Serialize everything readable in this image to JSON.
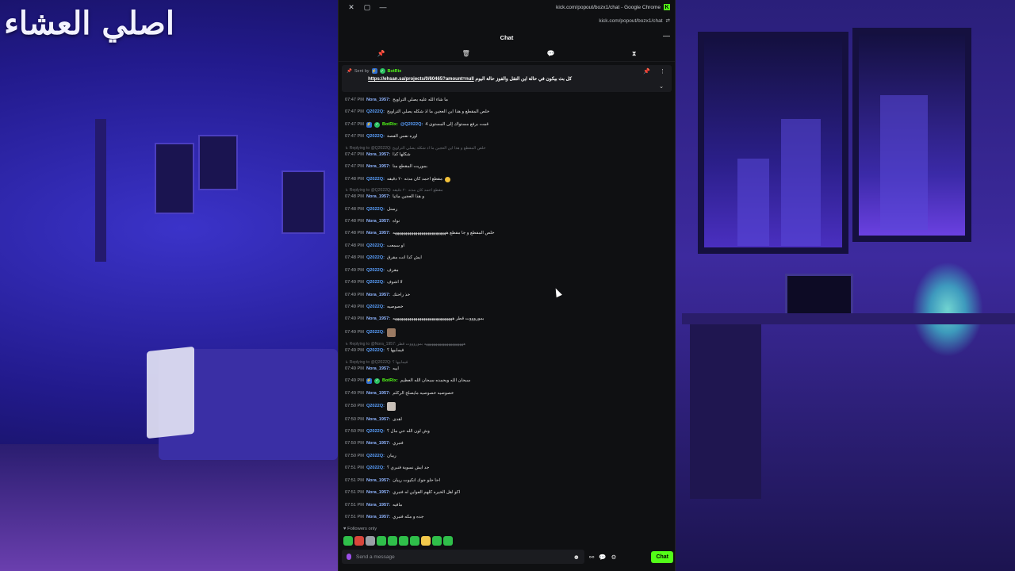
{
  "overlay_text": "اصلي العشاء",
  "window": {
    "title": "kick.com/popout/bozx1/chat - Google Chrome",
    "url": "kick.com/popout/bozx1/chat"
  },
  "chat": {
    "header": "Chat",
    "pinned": {
      "sent_by_label": "Sent by",
      "sender": "BotRix",
      "text": "كل بث بيكون في حالة اين التقل والفوز حالة اليوم",
      "link": "https://ehsan.sa/projects/0/60465?amount=null"
    },
    "messages": [
      {
        "time": "07:47 PM",
        "user": "Nora_1957",
        "ucls": "u-nora",
        "text": "ما شاء الله عليه يصلي التراويح"
      },
      {
        "time": "07:47 PM",
        "user": "Q2022Q",
        "ucls": "u-q",
        "text": "خلص المقطع و هذا اين العجين ما اذ شكله يصلي التراويح"
      },
      {
        "time": "07:47 PM",
        "user": "@Q2022Q",
        "ucls": "u-q",
        "bot_prefix": "BotRix",
        "text": "قمت برفع مستواك إلى المستوى 4"
      },
      {
        "time": "07:47 PM",
        "user": "Q2022Q",
        "ucls": "u-q",
        "text": "اوره نفس الفصة"
      },
      {
        "reply": "Replying to @Q2022Q: خلص المقطع و هذا اين العجين ما اذ شكله يصلي التراويح",
        "time": "07:47 PM",
        "user": "Nora_1957",
        "ucls": "u-nora",
        "text": "شكلها كذا"
      },
      {
        "time": "07:47 PM",
        "user": "Nora_1957",
        "ucls": "u-nora",
        "text": "بموريت المقطع منا"
      },
      {
        "time": "07:48 PM",
        "user": "Q2022Q",
        "ucls": "u-q",
        "text": "مقطع احمد كان مدته ٢٠ دقيقه",
        "emoji": true
      },
      {
        "reply": "Replying to @Q2022Q: مقطع احمد كان مدته ٢٠ دقيقه",
        "time": "07:48 PM",
        "user": "Nora_1957",
        "ucls": "u-nora",
        "text": "و هذا العجين ماتيا"
      },
      {
        "time": "07:48 PM",
        "user": "Q2022Q",
        "ucls": "u-q",
        "text": "رسنل"
      },
      {
        "time": "07:48 PM",
        "user": "Nora_1957",
        "ucls": "u-nora",
        "text": "نواه"
      },
      {
        "time": "07:48 PM",
        "user": "Nora_1957",
        "ucls": "u-nora",
        "text": "خلص المقطع و جا مقطع ههههههههههههههههههههههههههه"
      },
      {
        "time": "07:48 PM",
        "user": "Q2022Q",
        "ucls": "u-q",
        "text": "او سمعت"
      },
      {
        "time": "07:48 PM",
        "user": "Q2022Q",
        "ucls": "u-q",
        "text": "ايش كذا انت مقرق"
      },
      {
        "time": "07:49 PM",
        "user": "Q2022Q",
        "ucls": "u-q",
        "text": "مقرف"
      },
      {
        "time": "07:49 PM",
        "user": "Q2022Q",
        "ucls": "u-q",
        "text": "لا اشوف"
      },
      {
        "time": "07:49 PM",
        "user": "Nora_1957",
        "ucls": "u-nora",
        "text": "خذ راحتك"
      },
      {
        "time": "07:49 PM",
        "user": "Q2022Q",
        "ucls": "u-q",
        "text": "خصوصيه"
      },
      {
        "time": "07:49 PM",
        "user": "Nora_1957",
        "ucls": "u-nora",
        "text": "بموروووت قطر هههههههههههههههههههههههههههههه"
      },
      {
        "time": "07:49 PM",
        "user": "Q2022Q",
        "ucls": "u-q",
        "text": "",
        "emote": "#9b7a62"
      },
      {
        "reply": "Replying to @Nora_1957: هههههههههههههههههههههه بموروووت قطر",
        "time": "07:49 PM",
        "user": "Q2022Q",
        "ucls": "u-q",
        "text": "فيمابيها ؟"
      },
      {
        "reply": "Replying to @Q2022Q: فيمابيها ؟",
        "time": "07:49 PM",
        "user": "Nora_1957",
        "ucls": "u-nora",
        "text": "اييه"
      },
      {
        "time": "07:49 PM",
        "user": "BotRix",
        "ucls": "u-bot",
        "bot": true,
        "text": "سبحان الله وبحمده سبحان الله العظيم"
      },
      {
        "time": "07:49 PM",
        "user": "Nora_1957",
        "ucls": "u-nora",
        "text": "خصوصيه خصوصيه مايصلح الركلم"
      },
      {
        "time": "07:50 PM",
        "user": "Q2022Q",
        "ucls": "u-q",
        "text": "",
        "emote": "#c9c0b8"
      },
      {
        "time": "07:50 PM",
        "user": "Nora_1957",
        "ucls": "u-nora",
        "text": "اهدى"
      },
      {
        "time": "07:50 PM",
        "user": "Q2022Q",
        "ucls": "u-q",
        "text": "وش لون الله حي مال ؟"
      },
      {
        "time": "07:50 PM",
        "user": "Nora_1957",
        "ucls": "u-nora",
        "text": "فنبري"
      },
      {
        "time": "07:50 PM",
        "user": "Q2022Q",
        "ucls": "u-q",
        "text": "ريبان"
      },
      {
        "time": "07:51 PM",
        "user": "Q2022Q",
        "ucls": "u-q",
        "text": "جد ايش نسوية فنبري ؟"
      },
      {
        "time": "07:51 PM",
        "user": "Nora_1957",
        "ucls": "u-nora",
        "text": "احا حلو جوك انكيوت ريبان"
      },
      {
        "time": "07:51 PM",
        "user": "Nora_1957",
        "ucls": "u-nora",
        "text": "اكو اهل الخيره كلهم الفواين له فنبري"
      },
      {
        "time": "07:51 PM",
        "user": "Nora_1957",
        "ucls": "u-nora",
        "text": "مافيه"
      },
      {
        "time": "07:51 PM",
        "user": "Nora_1957",
        "ucls": "u-nora",
        "text": "جده و مكه فنبري"
      }
    ],
    "followers_only": "Followers only",
    "emote_colors": [
      "#2fbf4a",
      "#d8463b",
      "#9aa0a6",
      "#2fbf4a",
      "#2fbf4a",
      "#2fbf4a",
      "#2fbf4a",
      "#f2c94c",
      "#2fbf4a",
      "#2fbf4a"
    ],
    "input_placeholder": "Send a message",
    "send_label": "Chat"
  }
}
